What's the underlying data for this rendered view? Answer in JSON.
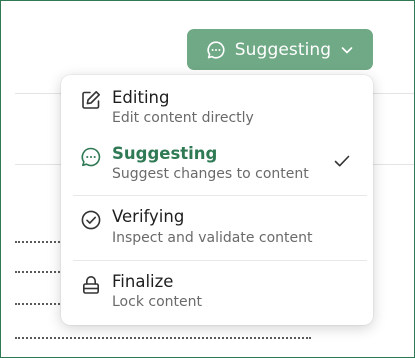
{
  "mode_button": {
    "label": "Suggesting",
    "icon": "speech-bubble-icon",
    "chevron": "chevron-down-icon"
  },
  "menu": {
    "items": [
      {
        "title": "Editing",
        "description": "Edit content directly",
        "icon": "edit-icon",
        "selected": false
      },
      {
        "title": "Suggesting",
        "description": "Suggest changes to content",
        "icon": "speech-bubble-icon",
        "selected": true
      },
      {
        "title": "Verifying",
        "description": "Inspect and validate content",
        "icon": "check-circle-icon",
        "selected": false
      },
      {
        "title": "Finalize",
        "description": "Lock content",
        "icon": "lock-icon",
        "selected": false
      }
    ]
  },
  "colors": {
    "accent": "#2f7a55",
    "button_bg": "#70a986",
    "title_text": "#1e1e1e",
    "description_text": "#6a6a6a"
  }
}
